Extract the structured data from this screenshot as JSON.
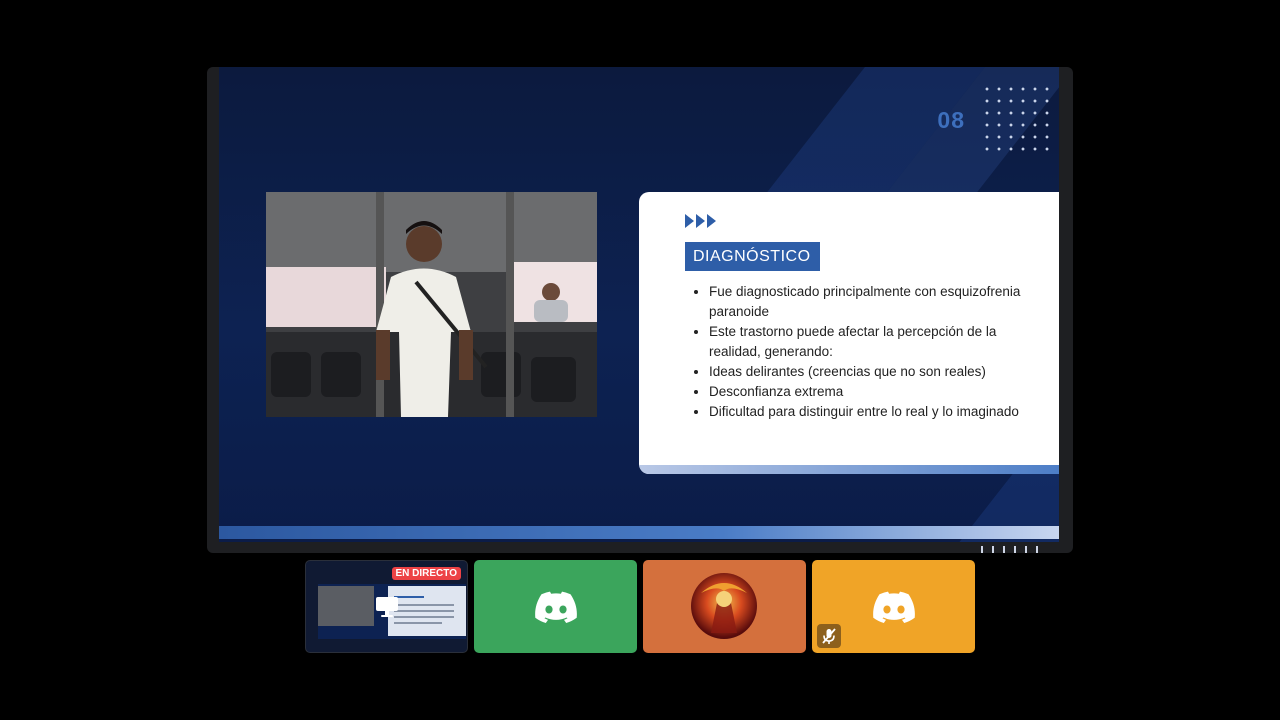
{
  "slide": {
    "number": "08",
    "section_title": "DIAGNÓSTICO",
    "bullets": [
      "Fue diagnosticado principalmente con esquizofrenia paranoide",
      "Este trastorno puede afectar la percepción de la realidad, generando:",
      "Ideas delirantes (creencias que no son reales)",
      "Desconfianza extrema",
      "Dificultad para distinguir entre lo real y lo imaginado"
    ]
  },
  "participants": {
    "screen_share": {
      "live_label": "EN DIRECTO",
      "icon": "monitor-icon"
    },
    "tiles": [
      {
        "color": "#3ba55c",
        "icon": "discord-icon"
      },
      {
        "color": "#d4703d",
        "icon": "avatar"
      },
      {
        "color": "#f0a427",
        "icon": "discord-icon",
        "muted": true
      }
    ]
  },
  "colors": {
    "accent": "#2e5ea8",
    "slide_bg": "#0d2252",
    "live_red": "#ed4245"
  }
}
